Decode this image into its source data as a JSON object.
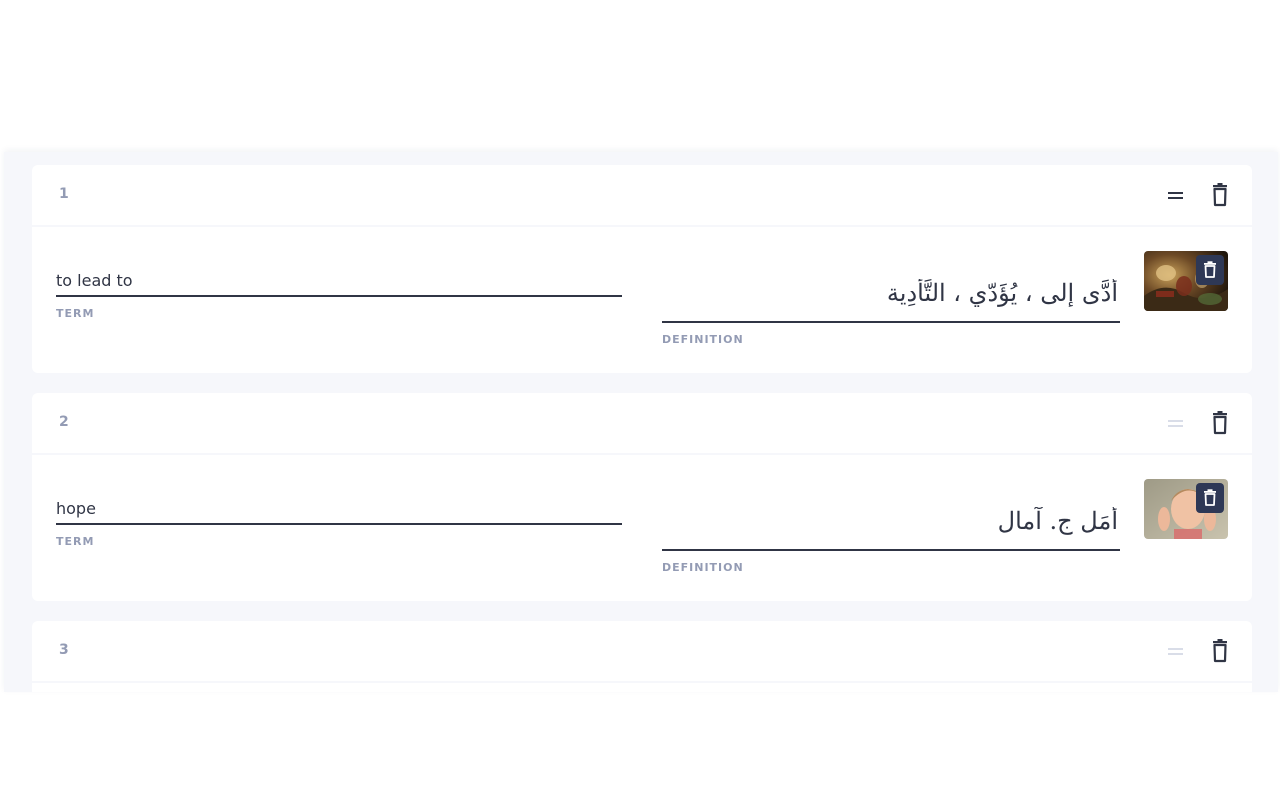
{
  "colors": {
    "background": "#f6f7fb",
    "card": "#ffffff",
    "text": "#303545",
    "label": "#939bb4",
    "active_handle": "#303545",
    "inactive_handle": "#d9dde8",
    "thumb_button": "#2e3856"
  },
  "cards": [
    {
      "number": "1",
      "term": "to lead to",
      "term_label": "TERM",
      "definition": "أَدَّى إلى ، يُؤَدّي ، التَّأْدِية",
      "definition_label": "DEFINITION",
      "image_icon": "painting-thumbnail",
      "handle_active": true
    },
    {
      "number": "2",
      "term": "hope",
      "term_label": "TERM",
      "definition": "أَمَل ج. آمال",
      "definition_label": "DEFINITION",
      "image_icon": "child-photo-thumbnail",
      "handle_active": false
    },
    {
      "number": "3",
      "handle_active": false
    }
  ]
}
